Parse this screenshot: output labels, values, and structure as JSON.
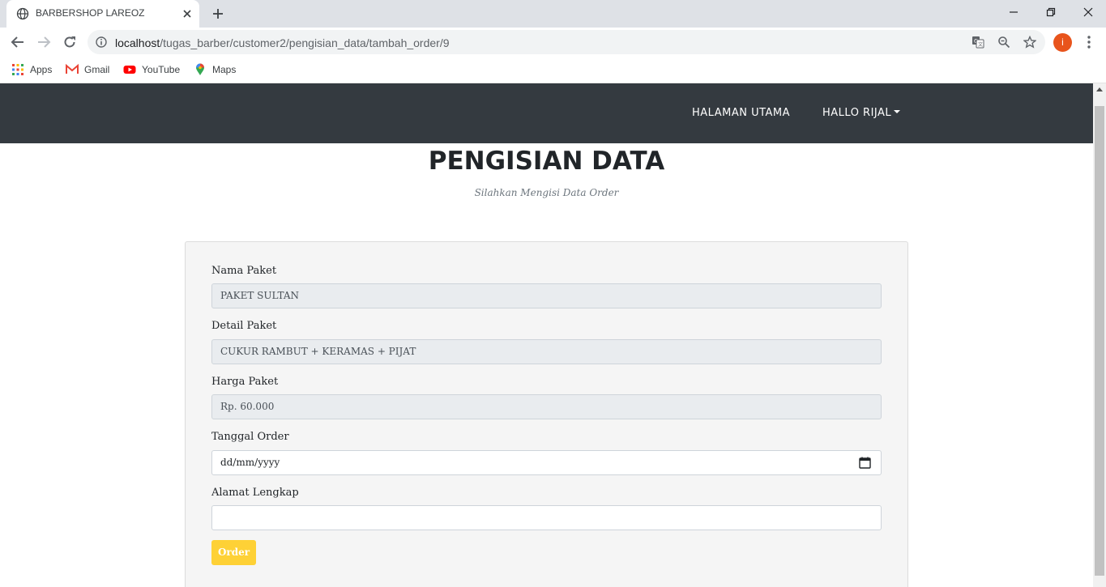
{
  "browser": {
    "tab_title": "BARBERSHOP LAREOZ",
    "url_host": "localhost",
    "url_path": "/tugas_barber/customer2/pengisian_data/tambah_order/9",
    "profile_initial": "i",
    "bookmarks": [
      "Apps",
      "Gmail",
      "YouTube",
      "Maps"
    ]
  },
  "navbar": {
    "home_label": "HALAMAN UTAMA",
    "user_label": "HALLO RIJAL"
  },
  "page": {
    "title": "PENGISIAN DATA",
    "subtitle": "Silahkan Mengisi Data Order"
  },
  "form": {
    "nama_paket": {
      "label": "Nama Paket",
      "value": "PAKET SULTAN"
    },
    "detail_paket": {
      "label": "Detail Paket",
      "value": "CUKUR RAMBUT + KERAMAS + PIJAT"
    },
    "harga_paket": {
      "label": "Harga Paket",
      "value": "Rp. 60.000"
    },
    "tanggal_order": {
      "label": "Tanggal Order",
      "placeholder": "dd/mm/yyyy"
    },
    "alamat": {
      "label": "Alamat Lengkap",
      "value": ""
    },
    "submit_label": "Order"
  },
  "colors": {
    "navbar_bg": "#343a40",
    "button_accent": "#fed136",
    "profile_avatar": "#e8541c"
  }
}
